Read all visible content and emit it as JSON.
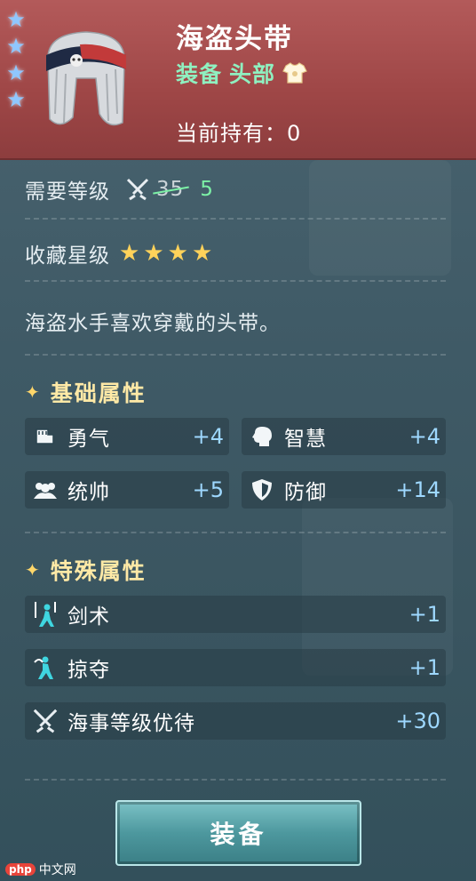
{
  "item": {
    "name": "海盗头带",
    "category": "装备",
    "slot": "头部",
    "owned_label": "当前持有：",
    "owned_count": "0",
    "rarity_stars": 4
  },
  "level": {
    "label": "需要等级",
    "original": "35",
    "current": "5",
    "icon": "crossed-swords-icon"
  },
  "collection": {
    "label": "收藏星级",
    "stars": 4
  },
  "description": "海盗水手喜欢穿戴的头带。",
  "basic_attributes": {
    "title": "基础属性",
    "items": [
      {
        "name": "勇气",
        "value": "+4",
        "icon": "fist-icon"
      },
      {
        "name": "智慧",
        "value": "+4",
        "icon": "head-icon"
      },
      {
        "name": "统帅",
        "value": "+5",
        "icon": "group-icon"
      },
      {
        "name": "防御",
        "value": "+14",
        "icon": "shield-icon"
      }
    ]
  },
  "special_attributes": {
    "title": "特殊属性",
    "items": [
      {
        "name": "剑术",
        "value": "+1",
        "icon": "swordsman-icon"
      },
      {
        "name": "掠夺",
        "value": "+1",
        "icon": "plunder-icon"
      },
      {
        "name": "海事等级优待",
        "value": "+30",
        "icon": "crossed-swords-icon"
      }
    ]
  },
  "actions": {
    "equip_label": "装备"
  },
  "watermark": {
    "logo": "php",
    "text": "中文网"
  },
  "colors": {
    "header_bg": "#a34c4c",
    "subtitle_green": "#8ff0c0",
    "level_green": "#7cf0a6",
    "value_blue": "#9ed8ff",
    "section_gold": "#ffe9a6",
    "star_gold": "#ffd25a",
    "star_blue": "#8fc7ff"
  }
}
